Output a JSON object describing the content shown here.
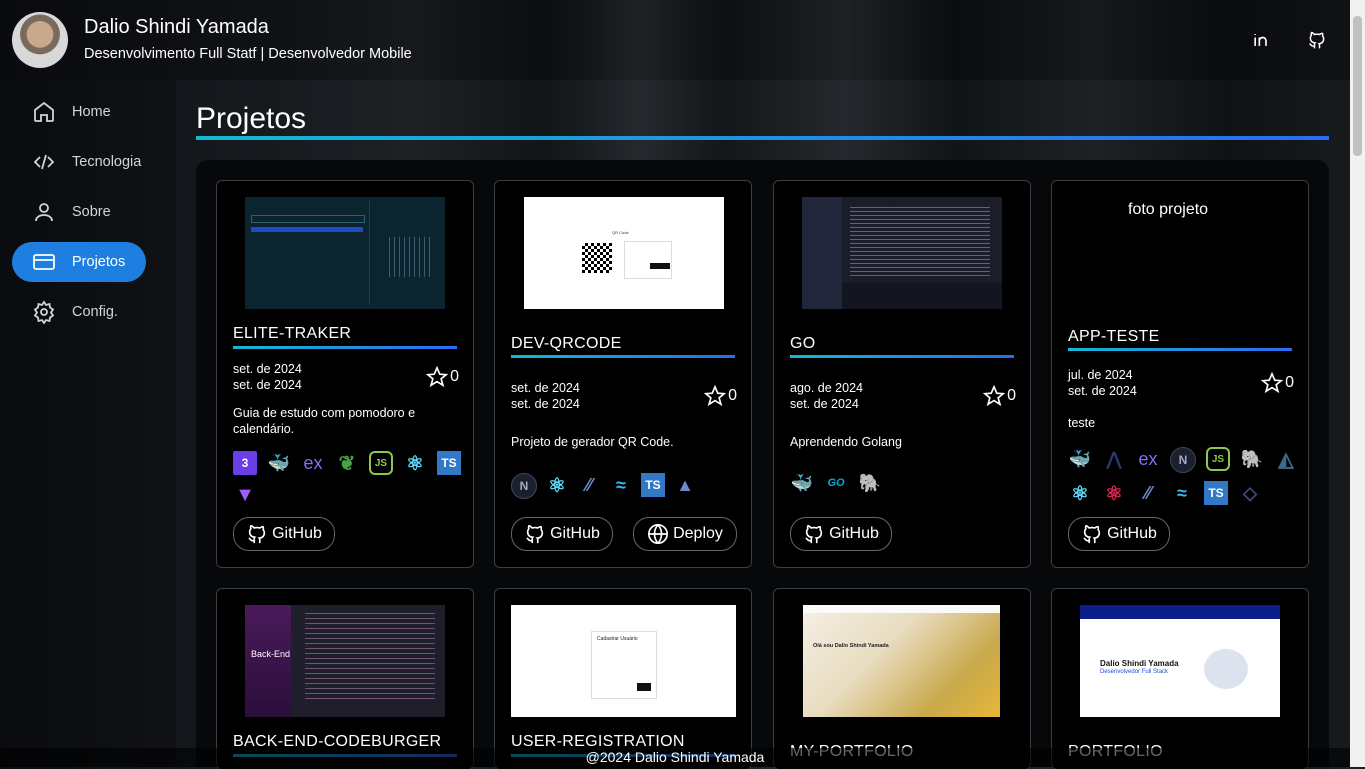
{
  "header": {
    "name": "Dalio Shindi Yamada",
    "subtitle": "Desenvolvimento Full Statf | Desenvolvedor Mobile"
  },
  "nav": [
    {
      "label": "Home",
      "icon": "home-icon"
    },
    {
      "label": "Tecnologia",
      "icon": "code-icon"
    },
    {
      "label": "Sobre",
      "icon": "user-icon"
    },
    {
      "label": "Projetos",
      "icon": "card-icon",
      "active": true
    },
    {
      "label": "Config.",
      "icon": "gear-icon"
    }
  ],
  "page_title": "Projetos",
  "cards": [
    {
      "title": "ELITE-TRAKER",
      "date1": "set. de 2024",
      "date2": "set. de 2024",
      "stars": "0",
      "desc": "Guia de estudo com pomodoro e calendário.",
      "techs": [
        "css3",
        "docker",
        "elixir",
        "mongodb",
        "nodejs",
        "react",
        "typescript",
        "vite"
      ],
      "buttons": [
        "GitHub"
      ]
    },
    {
      "title": "DEV-QRCODE",
      "date1": "set. de 2024",
      "date2": "set. de 2024",
      "stars": "0",
      "desc": "Projeto de gerador QR Code.",
      "techs": [
        "nextjs",
        "react",
        "shadcn",
        "tailwind",
        "typescript",
        "vercel"
      ],
      "buttons": [
        "GitHub",
        "Deploy"
      ]
    },
    {
      "title": "GO",
      "date1": "ago. de 2024",
      "date2": "set. de 2024",
      "stars": "0",
      "desc": "Aprendendo Golang",
      "techs": [
        "docker",
        "go",
        "postgresql"
      ],
      "buttons": [
        "GitHub"
      ]
    },
    {
      "title": "APP-TESTE",
      "date1": "jul. de 2024",
      "date2": "set. de 2024",
      "stars": "0",
      "desc": "teste",
      "thumb_alt": "foto projeto",
      "techs": [
        "docker",
        "arch",
        "elixir",
        "nextjs",
        "nodejs",
        "postgresql",
        "prisma",
        "react",
        "nestjs",
        "shadcn",
        "tailwind",
        "typescript",
        "zod"
      ],
      "buttons": [
        "GitHub"
      ]
    },
    {
      "title": "BACK-END-CODEBURGER"
    },
    {
      "title": "USER-REGISTRATION"
    },
    {
      "title": "MY-PORTFOLIO"
    },
    {
      "title": "PORTFOLIO"
    }
  ],
  "thumbs": {
    "qr_title": "QR Code",
    "reg_title": "Cadastrar Usuário",
    "portfolio1_heading": "Olá sou Dalio Shindi Yamada",
    "portfolio2_name": "Dalio Shindi Yamada",
    "portfolio2_role": "Desenvolvedor Full Stack",
    "burger_label": "Back-End"
  },
  "footer": "@2024 Dalio Shindi Yamada",
  "colors": {
    "accent": "#1f7fe0",
    "gradient_start": "#14b8d4",
    "gradient_end": "#2a6cf0"
  }
}
